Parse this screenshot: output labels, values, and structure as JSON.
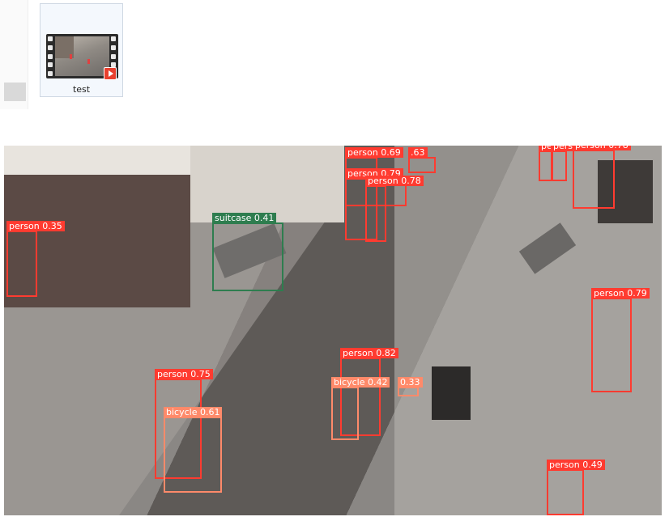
{
  "file_browser": {
    "file": {
      "name": "test",
      "icon": "video-file-icon"
    }
  },
  "detections": [
    {
      "label": "person 0.35",
      "class": "person"
    },
    {
      "label": "suitcase 0.41",
      "class": "suitcase"
    },
    {
      "label": "person 0.69",
      "class": "person"
    },
    {
      "label": ".63",
      "class": "person"
    },
    {
      "label": "person 0.79",
      "class": "person"
    },
    {
      "label": "person 0.78",
      "class": "person"
    },
    {
      "label": "pe",
      "class": "person"
    },
    {
      "label": "pers",
      "class": "person"
    },
    {
      "label": "person 0.78",
      "class": "person"
    },
    {
      "label": "person 0.79",
      "class": "person"
    },
    {
      "label": "person 0.82",
      "class": "person"
    },
    {
      "label": "bicycle 0.42",
      "class": "bicycle"
    },
    {
      "label": "0.33",
      "class": "bicycle"
    },
    {
      "label": "person 0.75",
      "class": "person"
    },
    {
      "label": "bicycle 0.61",
      "class": "bicycle"
    },
    {
      "label": "person 0.49",
      "class": "person"
    }
  ],
  "colors": {
    "person": "#ff3b30",
    "bicycle": "#ff8a6a",
    "suitcase": "#2e7d4f"
  }
}
